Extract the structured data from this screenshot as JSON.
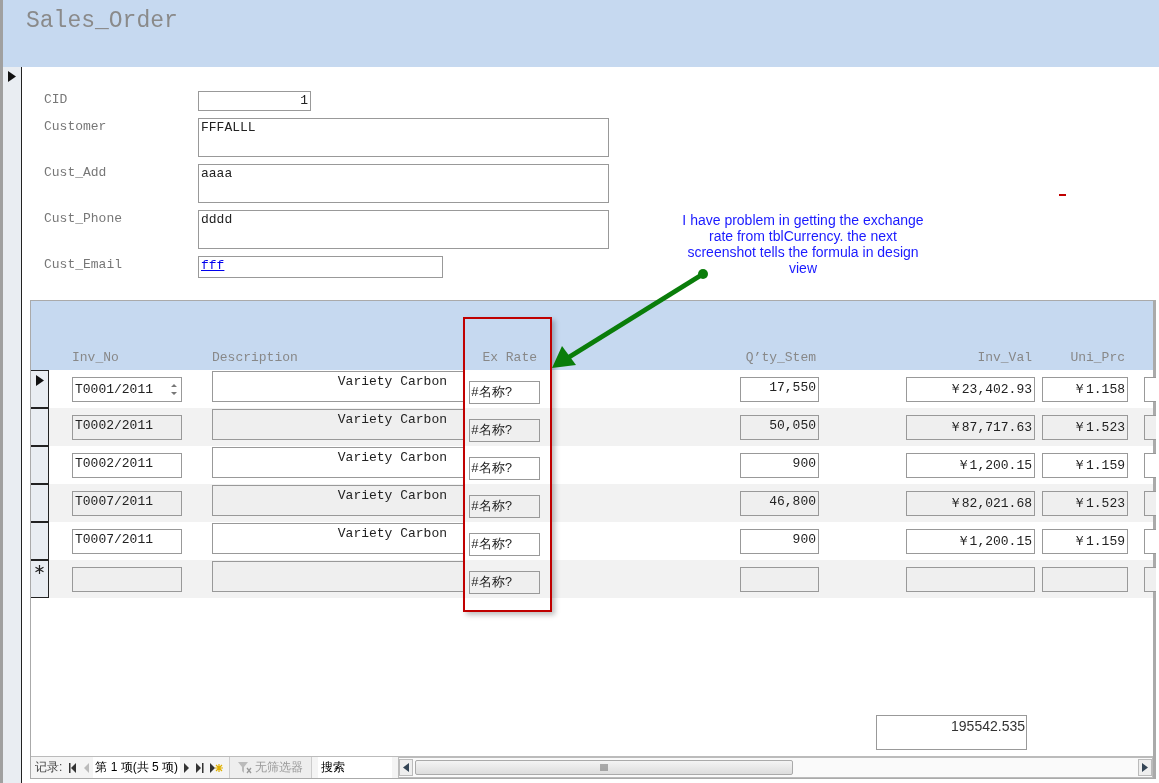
{
  "form": {
    "title": "Sales_Order"
  },
  "fields": [
    {
      "label": "CID",
      "value": "1",
      "kind": "number"
    },
    {
      "label": "Customer",
      "value": "FFFALLL",
      "kind": "memo"
    },
    {
      "label": "Cust_Add",
      "value": "aaaa",
      "kind": "memo"
    },
    {
      "label": "Cust_Phone",
      "value": "dddd",
      "kind": "memo"
    },
    {
      "label": "Cust_Email",
      "value": "fff",
      "kind": "link"
    }
  ],
  "subform": {
    "columns": [
      "Inv_No",
      "Description",
      "Ex Rate",
      "Q’ty_Stem",
      "Inv_Val",
      "Uni_Prc"
    ],
    "rows": [
      {
        "kind": "record",
        "selected": true,
        "cells": [
          "T0001/2011",
          "Variety Carbon",
          "#名称?",
          "17,550",
          "￥23,402.93",
          "￥1.158"
        ]
      },
      {
        "kind": "record",
        "selected": false,
        "cells": [
          "T0002/2011",
          "Variety Carbon",
          "#名称?",
          "50,050",
          "￥87,717.63",
          "￥1.523"
        ]
      },
      {
        "kind": "record",
        "selected": false,
        "cells": [
          "T0002/2011",
          "Variety Carbon",
          "#名称?",
          "900",
          "￥1,200.15",
          "￥1.159"
        ]
      },
      {
        "kind": "record",
        "selected": false,
        "cells": [
          "T0007/2011",
          "Variety Carbon",
          "#名称?",
          "46,800",
          "￥82,021.68",
          "￥1.523"
        ]
      },
      {
        "kind": "record",
        "selected": false,
        "cells": [
          "T0007/2011",
          "Variety Carbon",
          "#名称?",
          "900",
          "￥1,200.15",
          "￥1.159"
        ]
      },
      {
        "kind": "new",
        "selected": false,
        "cells": [
          "",
          "",
          "#名称?",
          "",
          "",
          ""
        ]
      }
    ],
    "total": "195542.535"
  },
  "navigation": {
    "label": "记录:",
    "position": "第 1 项(共 5 项)",
    "filter": "无筛选器",
    "search": "搜索"
  },
  "annotation": {
    "note": "I have problem in getting the exchange rate from tblCurrency. the next screenshot tells the formula in design view"
  }
}
